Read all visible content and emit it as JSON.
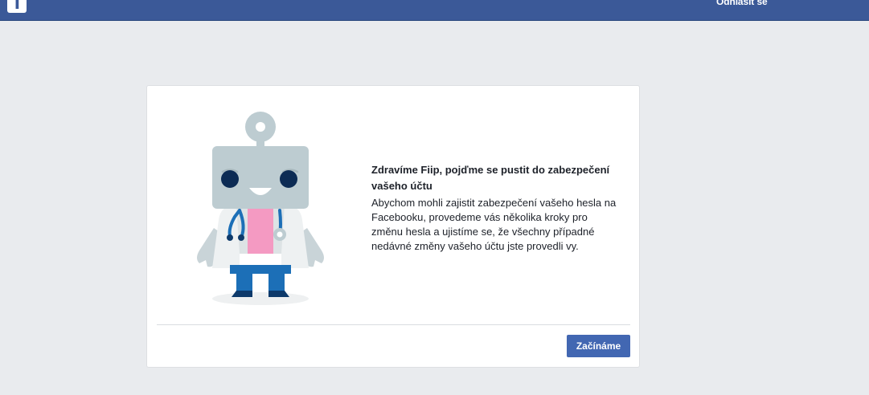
{
  "header": {
    "logo_icon": "facebook-f-logo",
    "logo_glyph": "f",
    "logout_label": "Odhlásit se",
    "bar_color": "#3b5998"
  },
  "card": {
    "illustration_icon": "robot-doctor-illustration",
    "headline": "Zdravíme Fiip, pojďme se pustit do zabezpečení vašeho účtu",
    "description": "Abychom mohli zajistit zabezpečení vašeho hesla na Facebooku, provedeme vás několika kroky pro změnu hesla a ujistíme se, že všechny případné nedávné změny vašeho účtu jste provedli vy.",
    "start_button_label": "Začínáme",
    "button_color": "#4267b2"
  }
}
